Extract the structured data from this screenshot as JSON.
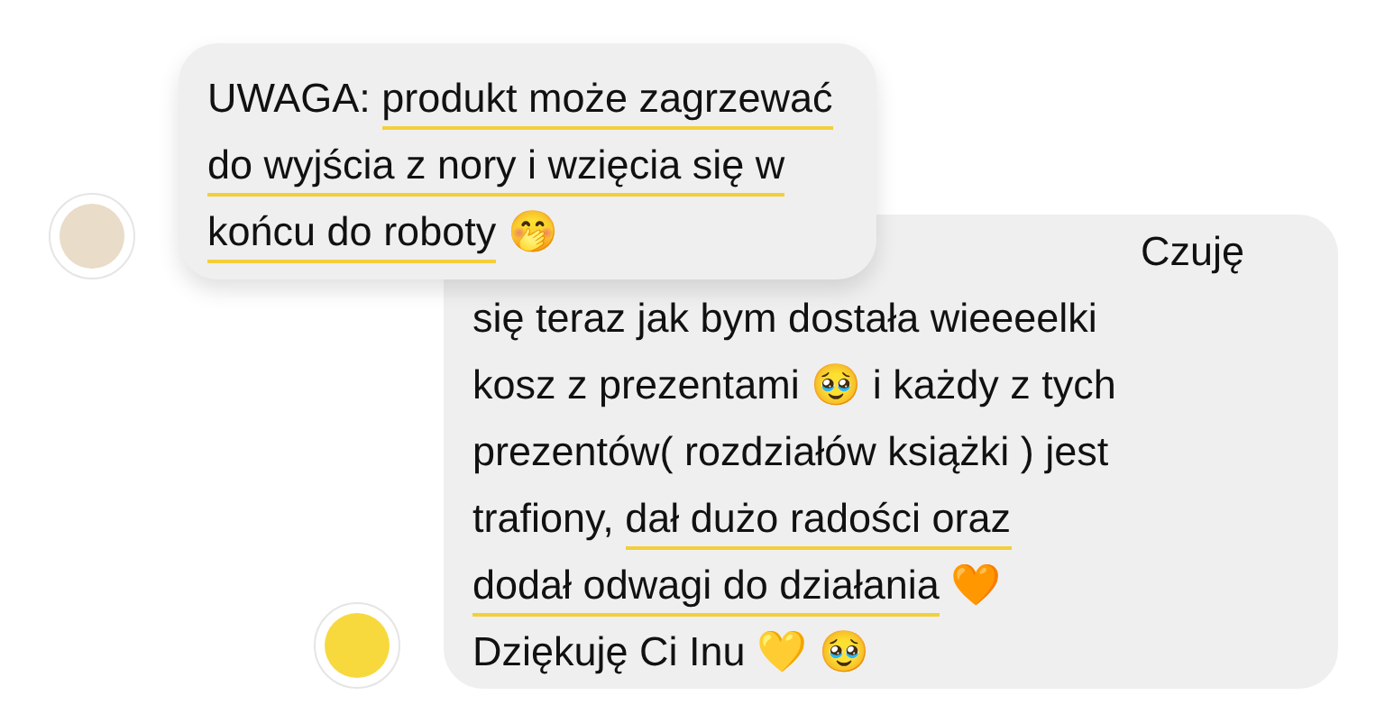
{
  "messages": [
    {
      "lines": [
        [
          {
            "text": "UWAGA: ",
            "underlined": false
          },
          {
            "text": "produkt może zagrzewać",
            "underlined": true
          }
        ],
        [
          {
            "text": "do wyjścia z nory i wzięcia się w",
            "underlined": true
          }
        ],
        [
          {
            "text": "końcu do roboty",
            "underlined": true
          },
          {
            "text": " 🤭",
            "underlined": false
          }
        ]
      ]
    },
    {
      "lines": [
        [
          {
            "text": "Czuję",
            "underlined": false
          }
        ],
        [
          {
            "text": "się teraz jak bym dostała wieeeelki",
            "underlined": false
          }
        ],
        [
          {
            "text": "kosz z prezentami 🥹 i każdy z tych",
            "underlined": false
          }
        ],
        [
          {
            "text": "prezentów( rozdziałów książki ) jest",
            "underlined": false
          }
        ],
        [
          {
            "text": "trafiony, ",
            "underlined": false
          },
          {
            "text": "dał dużo radości oraz",
            "underlined": true
          }
        ],
        [
          {
            "text": "dodał odwagi do działania",
            "underlined": true
          },
          {
            "text": " 🧡",
            "underlined": false
          }
        ],
        [
          {
            "text": "Dziękuję Ci Inu 💛 🥹",
            "underlined": false
          }
        ]
      ]
    }
  ]
}
